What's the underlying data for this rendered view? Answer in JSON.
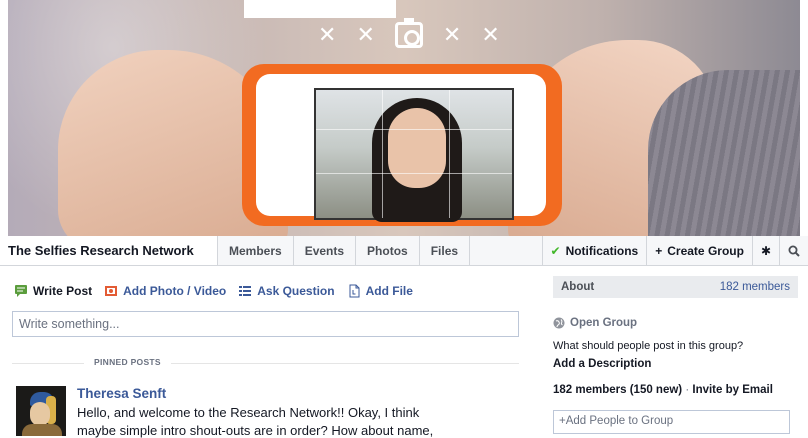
{
  "cover": {
    "icons": [
      "x-icon",
      "x-icon",
      "camera-icon",
      "x-icon",
      "x-icon"
    ],
    "accent": "#f26b21"
  },
  "nav": {
    "group_name": "The Selfies Research Network",
    "tabs": [
      "Members",
      "Events",
      "Photos",
      "Files"
    ],
    "notifications_label": "Notifications",
    "create_group_label": "Create Group"
  },
  "composer": {
    "actions": [
      "Write Post",
      "Add Photo / Video",
      "Ask Question",
      "Add File"
    ],
    "placeholder": "Write something..."
  },
  "pinned": {
    "label": "PINNED POSTS"
  },
  "post": {
    "author": "Theresa Senft",
    "lines": [
      "Hello, and welcome to the Research Network!! Okay, I think",
      "maybe simple intro shout-outs are in order? How about name,"
    ]
  },
  "sidebar": {
    "about_title": "About",
    "member_count": "182 members",
    "privacy": "Open Group",
    "question": "What should people post in this group?",
    "add_description": "Add a Description",
    "members_summary": "182 members (150 new)",
    "separator": "·",
    "invite_label": "Invite by Email",
    "add_people_placeholder": "Add People to Group"
  },
  "colors": {
    "link": "#3b5998",
    "check": "#42b72a"
  }
}
